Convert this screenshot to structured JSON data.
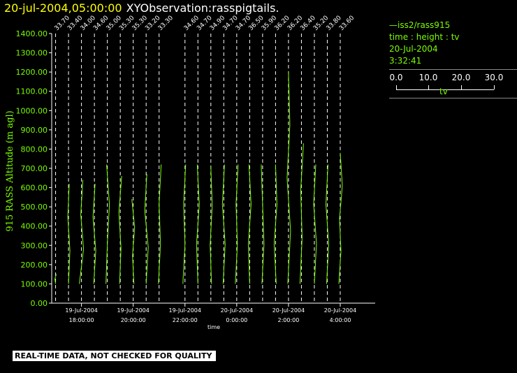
{
  "header": {
    "timestamp": "20-jul-2004,05:00:00",
    "observation": "XYObservation:rasspigtails."
  },
  "legend": {
    "series_label": "iss2/rass915",
    "line1": "time : height : tv",
    "line2": "20-Jul-2004",
    "line3": "3:32:41",
    "scale_ticks": [
      "0.0",
      "10.0",
      "20.0",
      "30.0"
    ],
    "scale_label": "tv"
  },
  "footer": {
    "text": "REAL-TIME DATA, NOT CHECKED FOR QUALITY"
  },
  "colors": {
    "trace": "#7cfc00",
    "timestamp": "#ffff00",
    "background": "#000000"
  },
  "chart_data": {
    "type": "line",
    "ylabel": "915 RASS Altitude (m agl)",
    "xlabel": "time",
    "ylim": [
      0,
      1400
    ],
    "yticks": [
      "0.00",
      "100.00",
      "200.00",
      "300.00",
      "400.00",
      "500.00",
      "600.00",
      "700.00",
      "800.00",
      "900.00",
      "1000.00",
      "1100.00",
      "1200.00",
      "1300.00",
      "1400.00"
    ],
    "xlim_hours": [
      16.85,
      5.35
    ],
    "xticks": [
      {
        "date": "19-Jul-2004",
        "time": "18:00:00",
        "hour": 18
      },
      {
        "date": "19-Jul-2004",
        "time": "20:00:00",
        "hour": 20
      },
      {
        "date": "19-Jul-2004",
        "time": "22:00:00",
        "hour": 22
      },
      {
        "date": "20-Jul-2004",
        "time": "0:00:00",
        "hour": 24
      },
      {
        "date": "20-Jul-2004",
        "time": "2:00:00",
        "hour": 26
      },
      {
        "date": "20-Jul-2004",
        "time": "4:00:00",
        "hour": 28
      }
    ],
    "profiles": [
      {
        "time": "17:00",
        "tv_label": "33.70",
        "ymax": 150,
        "wiggle": [
          3,
          2,
          4
        ]
      },
      {
        "time": "17:30",
        "tv_label": "33.40",
        "ymax": 620,
        "wiggle": [
          3,
          5,
          2,
          4
        ]
      },
      {
        "time": "18:00",
        "tv_label": "34.00",
        "ymax": 640,
        "wiggle": [
          0,
          6,
          2,
          5
        ]
      },
      {
        "time": "18:30",
        "tv_label": "34.60",
        "ymax": 620,
        "wiggle": [
          2,
          5,
          1,
          4
        ]
      },
      {
        "time": "19:00",
        "tv_label": "35.00",
        "ymax": 720,
        "wiggle": [
          1,
          3,
          6,
          2
        ]
      },
      {
        "time": "19:30",
        "tv_label": "35.30",
        "ymax": 660,
        "wiggle": [
          2,
          4,
          1,
          5
        ]
      },
      {
        "time": "20:00",
        "tv_label": "35.30",
        "ymax": 540,
        "wiggle": [
          4,
          2,
          5,
          1
        ]
      },
      {
        "time": "20:30",
        "tv_label": "33.20",
        "ymax": 670,
        "wiggle": [
          3,
          6,
          1,
          4
        ]
      },
      {
        "time": "21:00",
        "tv_label": "33.30",
        "ymax": 720,
        "wiggle": [
          2,
          5,
          3,
          6
        ]
      },
      {
        "time": "22:00",
        "tv_label": "34.60",
        "ymax": 720,
        "wiggle": [
          0,
          3,
          1,
          4
        ]
      },
      {
        "time": "22:30",
        "tv_label": "34.70",
        "ymax": 720,
        "wiggle": [
          3,
          1,
          5,
          2
        ]
      },
      {
        "time": "23:00",
        "tv_label": "34.90",
        "ymax": 710,
        "wiggle": [
          4,
          2,
          5,
          3
        ]
      },
      {
        "time": "23:30",
        "tv_label": "34.70",
        "ymax": 720,
        "wiggle": [
          2,
          5,
          1,
          4
        ]
      },
      {
        "time": "0:00",
        "tv_label": "34.70",
        "ymax": 720,
        "wiggle": [
          1,
          4,
          2,
          5
        ]
      },
      {
        "time": "0:30",
        "tv_label": "36.50",
        "ymax": 720,
        "wiggle": [
          3,
          1,
          5,
          2
        ]
      },
      {
        "time": "1:00",
        "tv_label": "35.90",
        "ymax": 720,
        "wiggle": [
          2,
          5,
          3,
          1
        ]
      },
      {
        "time": "1:30",
        "tv_label": "36.20",
        "ymax": 720,
        "wiggle": [
          4,
          1,
          5,
          3
        ]
      },
      {
        "time": "2:00",
        "tv_label": "36.20",
        "ymax": 1200,
        "wiggle": [
          2,
          6,
          1,
          5,
          3
        ]
      },
      {
        "time": "2:30",
        "tv_label": "36.40",
        "ymax": 830,
        "wiggle": [
          1,
          4,
          2,
          6
        ]
      },
      {
        "time": "3:00",
        "tv_label": "35.20",
        "ymax": 720,
        "wiggle": [
          3,
          6,
          2,
          5
        ]
      },
      {
        "time": "3:30",
        "tv_label": "33.80",
        "ymax": 720,
        "wiggle": [
          2,
          5,
          1,
          4
        ]
      },
      {
        "time": "4:00",
        "tv_label": "33.60",
        "ymax": 780,
        "wiggle": [
          1,
          4,
          2,
          6,
          3
        ]
      }
    ]
  }
}
